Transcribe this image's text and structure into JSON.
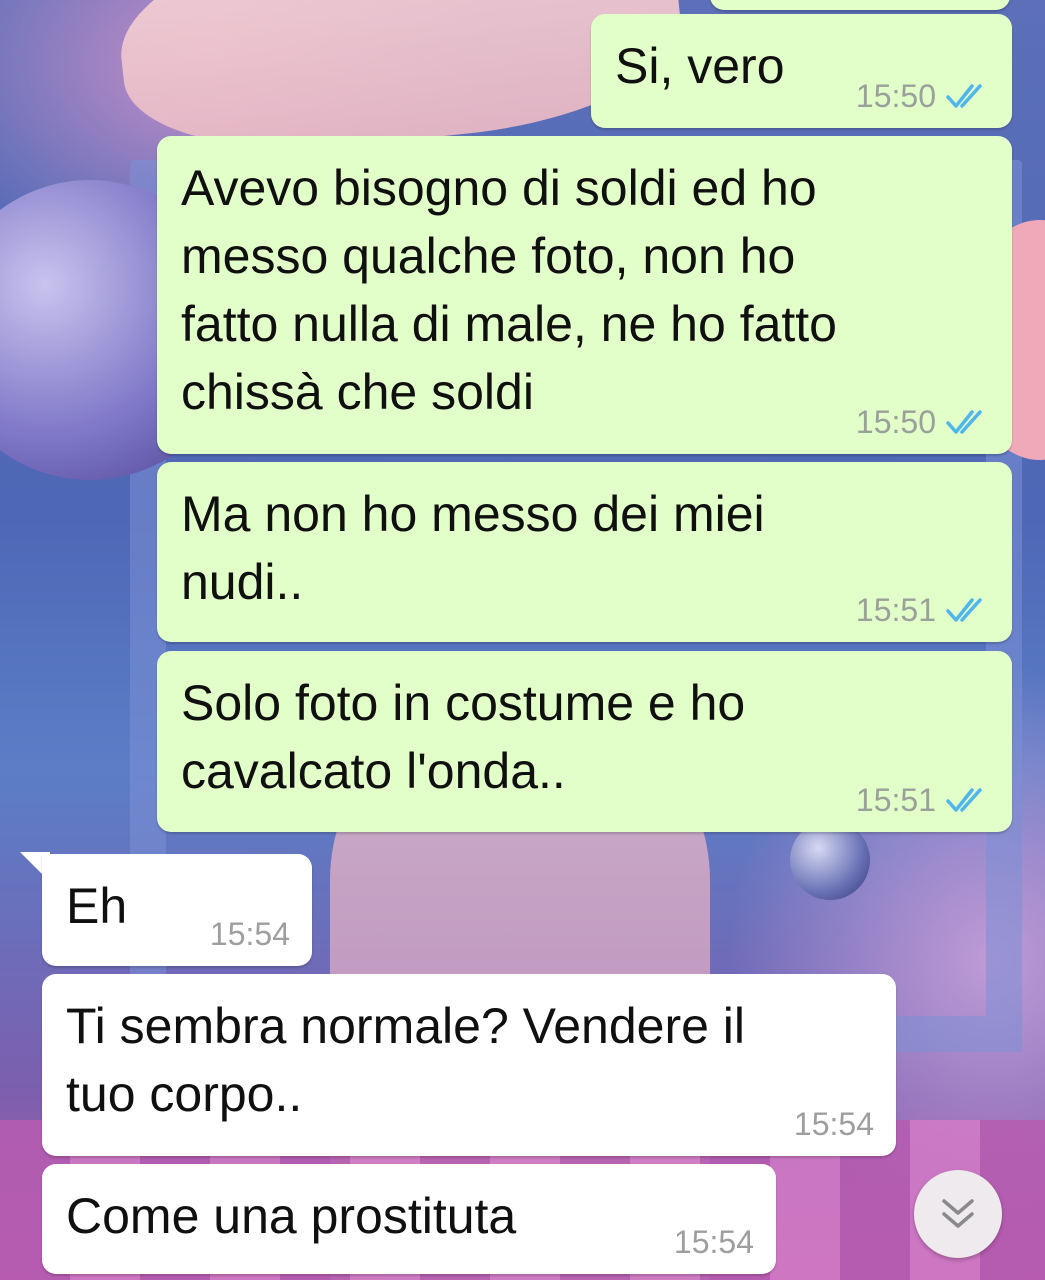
{
  "chat": {
    "messages": [
      {
        "id": "m1",
        "direction": "out",
        "text": "Si, vero",
        "time": "15:50",
        "status": "read"
      },
      {
        "id": "m2",
        "direction": "out",
        "text": "Avevo bisogno di soldi ed ho\nmesso qualche foto, non ho\nfatto nulla di male, ne ho fatto\nchissà che soldi",
        "time": "15:50",
        "status": "read"
      },
      {
        "id": "m3",
        "direction": "out",
        "text": "Ma non ho messo dei miei\nnudi..",
        "time": "15:51",
        "status": "read"
      },
      {
        "id": "m4",
        "direction": "out",
        "text": "Solo foto in costume e ho\ncavalcato l'onda..",
        "time": "15:51",
        "status": "read"
      },
      {
        "id": "m5",
        "direction": "in",
        "text": "Eh",
        "time": "15:54"
      },
      {
        "id": "m6",
        "direction": "in",
        "text": "Ti sembra normale? Vendere il\ntuo corpo..",
        "time": "15:54"
      },
      {
        "id": "m7",
        "direction": "in",
        "text": "Come una prostituta",
        "time": "15:54"
      }
    ]
  },
  "colors": {
    "outgoing_bubble": "#e2fec9",
    "incoming_bubble": "#ffffff",
    "read_check": "#4fb6ec",
    "time_text": "#9aa09a"
  },
  "icons": {
    "read_receipt": "double-check-icon",
    "scroll_down": "chevron-double-down-icon"
  }
}
